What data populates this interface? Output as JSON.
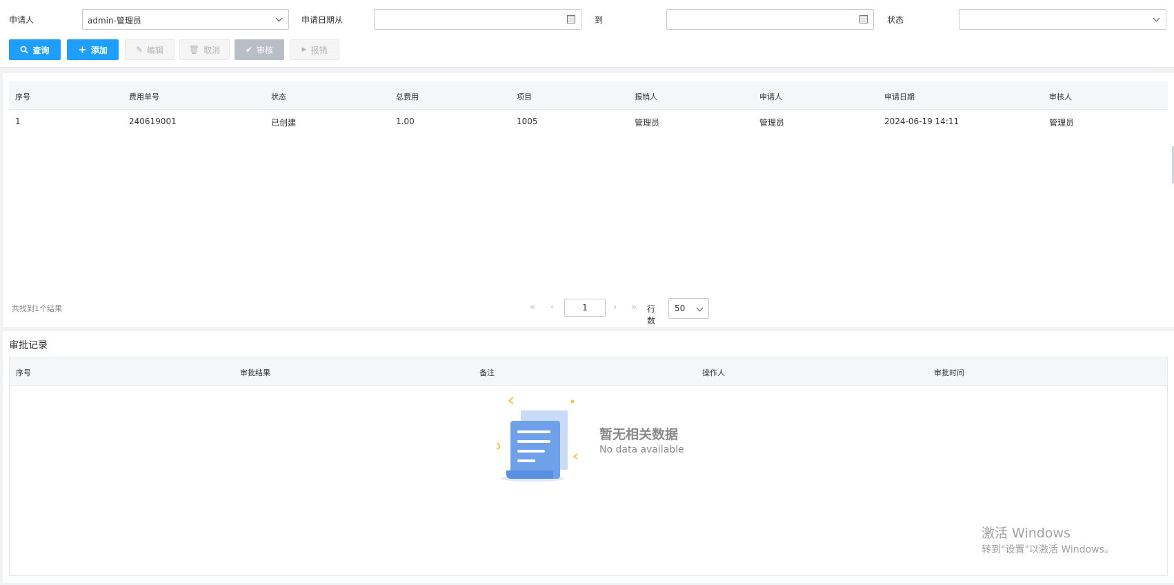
{
  "filters": {
    "applicant_label": "申请人",
    "applicant_value": "admin-管理员",
    "date_from_label": "申请日期从",
    "date_from_value": "",
    "date_to_label": "到",
    "date_to_value": "",
    "status_label": "状态",
    "status_value": ""
  },
  "toolbar": {
    "query": "查询",
    "add": "添加",
    "edit": "编辑",
    "cancel": "取消",
    "audit": "审核",
    "reimburse": "报销"
  },
  "expense_table": {
    "columns": [
      "序号",
      "费用单号",
      "状态",
      "总费用",
      "项目",
      "报销人",
      "申请人",
      "申请日期",
      "审核人"
    ],
    "rows": [
      [
        "1",
        "240619001",
        "已创建",
        "1.00",
        "1005",
        "管理员",
        "管理员",
        "2024-06-19 14:11",
        "管理员"
      ]
    ]
  },
  "pagination": {
    "summary": "共找到1个结果",
    "current_page": "1",
    "rows_label": "行数",
    "rows_per_page": "50"
  },
  "approval": {
    "title": "审批记录",
    "columns": [
      "序号",
      "审批结果",
      "备注",
      "操作人",
      "审批时间"
    ],
    "empty_title": "暂无相关数据",
    "empty_subtitle": "No data available"
  },
  "watermark": {
    "title": "激活 Windows",
    "subtitle": "转到\"设置\"以激活 Windows。"
  },
  "colors": {
    "primary": "#1e9fff",
    "disabled_bg": "#f5f5f5",
    "illustration_blue": "#6fa0ea",
    "illustration_accent": "#f5c542"
  },
  "icons": [
    "search-icon",
    "plus-icon",
    "edit-icon",
    "trash-icon",
    "check-icon",
    "play-icon",
    "calendar-icon",
    "chevron-down-icon",
    "first-page-icon",
    "prev-page-icon",
    "next-page-icon",
    "last-page-icon"
  ]
}
